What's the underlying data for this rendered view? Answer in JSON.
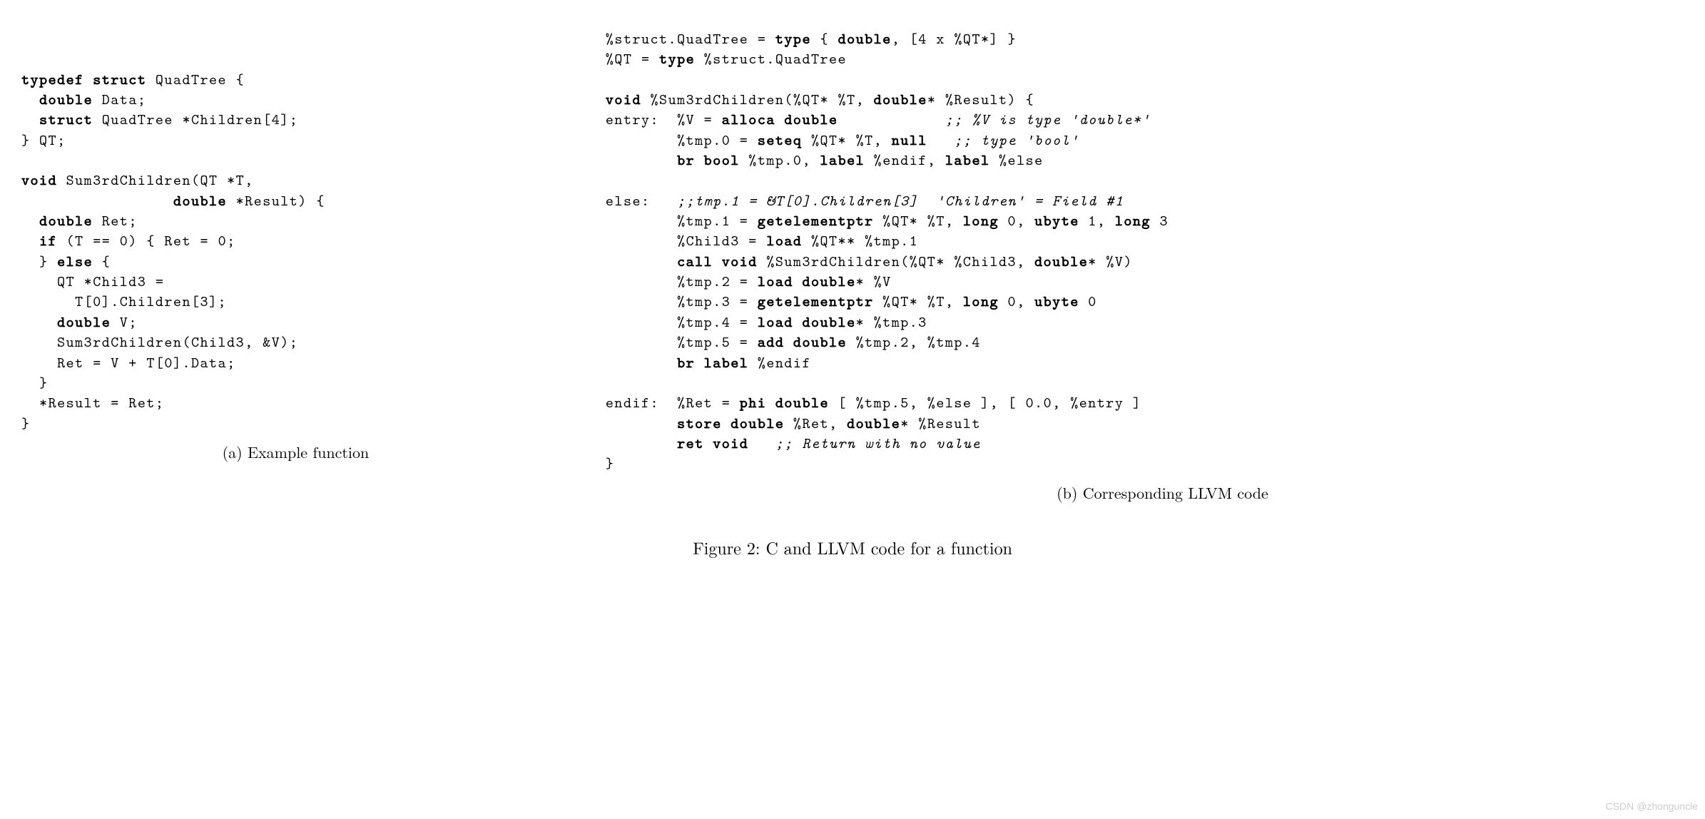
{
  "figure": {
    "caption": "Figure 2: C and LLVM code for a function",
    "left": {
      "subcaption": "(a) Example function",
      "code_html": "<b>typedef struct</b> QuadTree {\n  <b>double</b> Data;\n  <b>struct</b> QuadTree *Children[4];\n} QT;\n\n<b>void</b> Sum3rdChildren(QT *T,\n                 <b>double</b> *Result) {\n  <b>double</b> Ret;\n  <b>if</b> (T == 0) { Ret = 0;\n  } <b>else</b> {\n    QT *Child3 =\n      T[0].Children[3];\n    <b>double</b> V;\n    Sum3rdChildren(Child3, &amp;V);\n    Ret = V + T[0].Data;\n  }\n  *Result = Ret;\n}"
    },
    "right": {
      "subcaption": "(b) Corresponding LLVM code",
      "code_html": "%struct.QuadTree = <b>type</b> { <b>double</b>, [4 x %QT*] }\n%QT = <b>type</b> %struct.QuadTree\n\n<b>void</b> %Sum3rdChildren(%QT* %T, <b>double</b>* %Result) {\nentry:  %V = <b>alloca double</b>            <i>;; %V is type 'double*'</i>\n        %tmp.0 = <b>seteq</b> %QT* %T, <b>null</b>   <i>;; type 'bool'</i>\n        <b>br bool</b> %tmp.0, <b>label</b> %endif, <b>label</b> %else\n\nelse:   <i>;;tmp.1 = &amp;T[0].Children[3]  'Children' = Field #1</i>\n        %tmp.1 = <b>getelementptr</b> %QT* %T, <b>long</b> 0, <b>ubyte</b> 1, <b>long</b> 3\n        %Child3 = <b>load</b> %QT** %tmp.1\n        <b>call void</b> %Sum3rdChildren(%QT* %Child3, <b>double</b>* %V)\n        %tmp.2 = <b>load double</b>* %V\n        %tmp.3 = <b>getelementptr</b> %QT* %T, <b>long</b> 0, <b>ubyte</b> 0\n        %tmp.4 = <b>load double</b>* %tmp.3\n        %tmp.5 = <b>add double</b> %tmp.2, %tmp.4\n        <b>br label</b> %endif\n\nendif:  %Ret = <b>phi double</b> [ %tmp.5, %else ], [ 0.0, %entry ]\n        <b>store double</b> %Ret, <b>double</b>* %Result\n        <b>ret void</b>   <i>;; Return with no value</i>\n}"
    }
  },
  "watermark": "CSDN @zhonguncle"
}
